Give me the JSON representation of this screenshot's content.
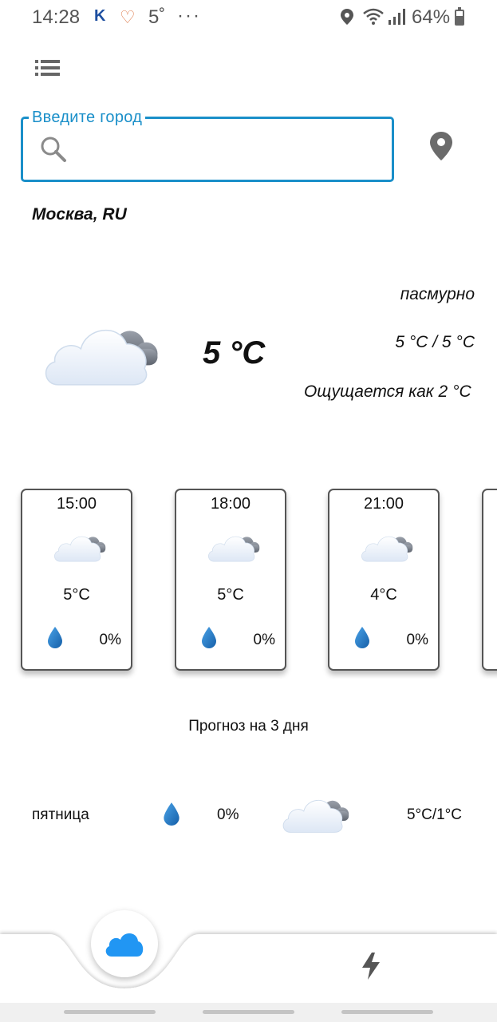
{
  "status_bar": {
    "time": "14:28",
    "k_label": "K",
    "temp": "5˚",
    "dots": "···",
    "battery": "64%"
  },
  "search": {
    "label": "Введите город",
    "value": "",
    "placeholder": ""
  },
  "city": "Москва, RU",
  "current": {
    "temp": "5 °C",
    "description": "пасмурно",
    "minmax": "5 °C / 5 °C",
    "feels_like": "Ощущается как 2 °C",
    "icon": "overcast-cloud-icon"
  },
  "hourly": [
    {
      "time": "15:00",
      "temp": "5°C",
      "precip": "0%",
      "icon": "overcast-cloud-icon"
    },
    {
      "time": "18:00",
      "temp": "5°C",
      "precip": "0%",
      "icon": "overcast-cloud-icon"
    },
    {
      "time": "21:00",
      "temp": "4°C",
      "precip": "0%",
      "icon": "overcast-cloud-icon"
    }
  ],
  "forecast": {
    "title": "Прогноз на 3 дня",
    "days": [
      {
        "day": "пятница",
        "precip": "0%",
        "range": "5°C/1°C",
        "icon": "overcast-cloud-icon"
      }
    ]
  },
  "nav": {
    "items": [
      {
        "icon": "cloud-icon",
        "active": true
      },
      {
        "icon": "lightning-icon",
        "active": false
      }
    ]
  },
  "colors": {
    "accent": "#1a8fc9",
    "nav_cloud": "#2196f3",
    "drop": "#1f73bd"
  }
}
